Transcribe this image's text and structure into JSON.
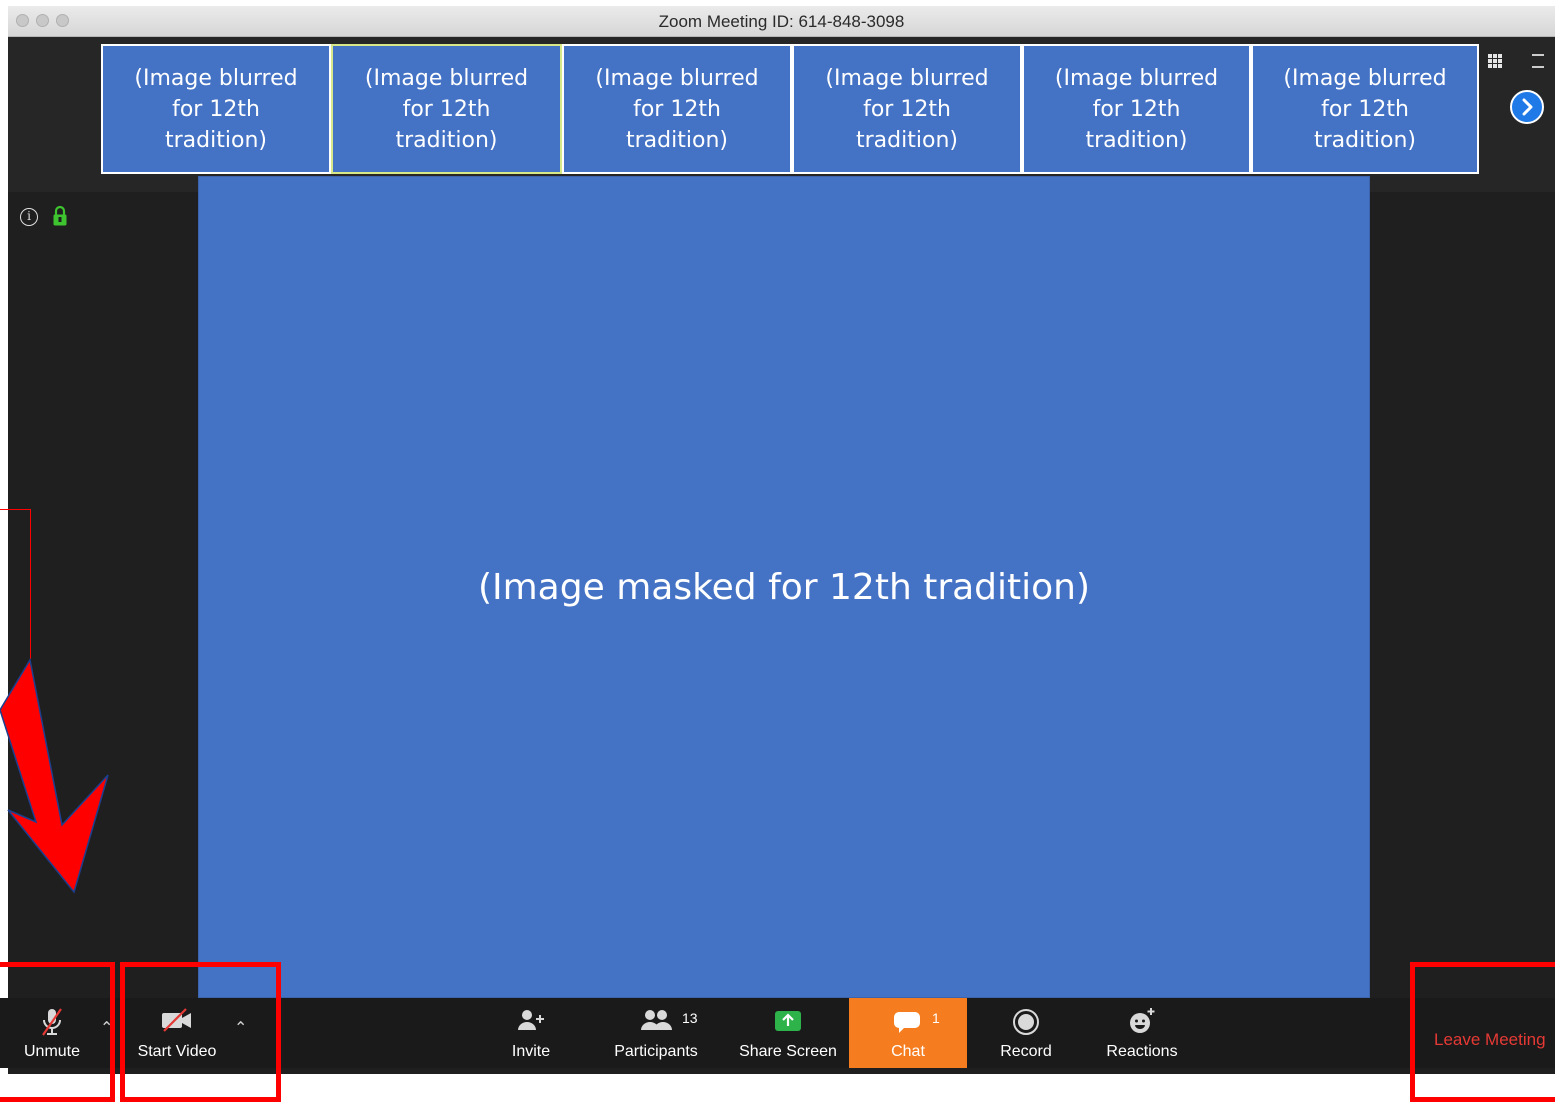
{
  "window": {
    "title": "Zoom Meeting ID: 614-848-3098"
  },
  "gallery": {
    "thumbnails": [
      {
        "label": "(Image blurred\nfor 12th\ntradition)"
      },
      {
        "label": "(Image blurred\nfor 12th\ntradition)"
      },
      {
        "label": "(Image blurred\nfor 12th\ntradition)"
      },
      {
        "label": "(Image blurred\nfor 12th\ntradition)"
      },
      {
        "label": "(Image blurred\nfor 12th\ntradition)"
      },
      {
        "label": "(Image blurred\nfor 12th\ntradition)"
      }
    ],
    "view_icon": "grid-icon",
    "next_icon": "chevron-right-icon"
  },
  "stage": {
    "label": "(Image masked for 12th tradition)"
  },
  "toolbar": {
    "unmute_label": "Unmute",
    "start_video_label": "Start Video",
    "invite_label": "Invite",
    "participants_label": "Participants",
    "participants_count": "13",
    "share_screen_label": "Share Screen",
    "chat_label": "Chat",
    "chat_count": "1",
    "record_label": "Record",
    "reactions_label": "Reactions",
    "leave_label": "Leave Meeting"
  },
  "colors": {
    "tile_blue": "#4472c4",
    "chat_orange": "#f57d1f",
    "share_green": "#2db34a",
    "leave_red": "#e53935",
    "annotation_red": "#ff0000"
  }
}
